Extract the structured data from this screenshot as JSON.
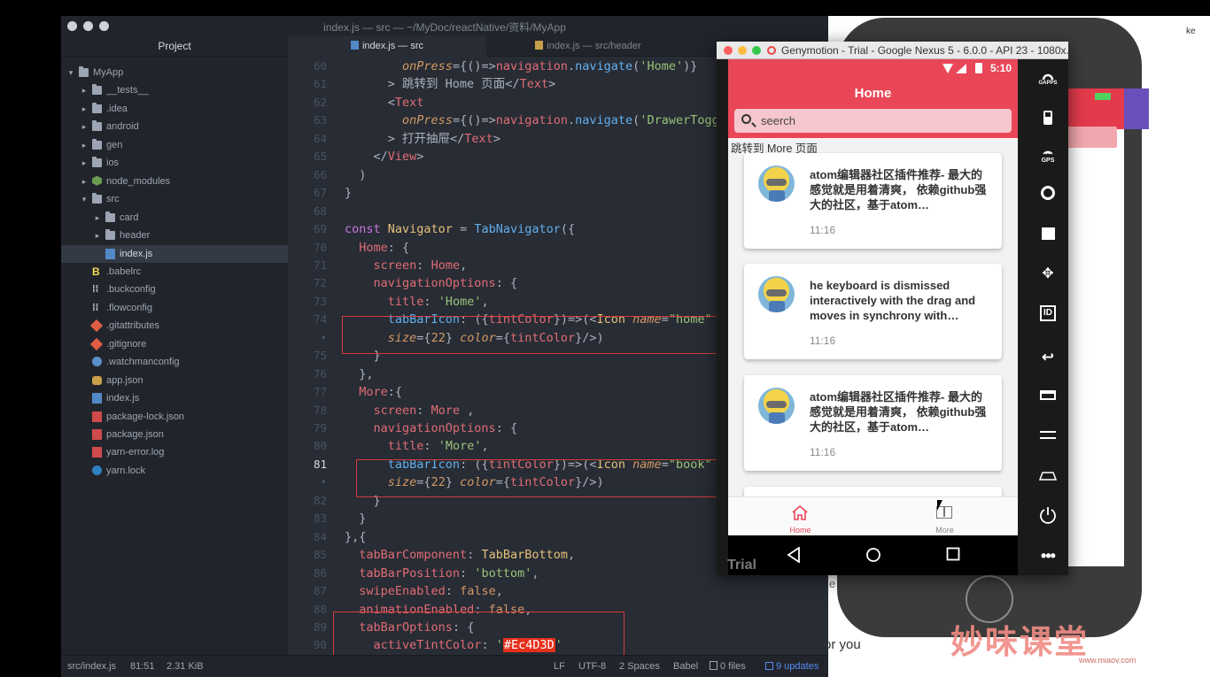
{
  "atom": {
    "window_title": "index.js — src — ~/MyDoc/reactNative/资料/MyApp",
    "tree_header": "Project",
    "tree": [
      {
        "label": "MyApp",
        "kind": "folder",
        "chev": "▾",
        "depth": 0
      },
      {
        "label": "__tests__",
        "kind": "folder",
        "chev": "▸",
        "depth": 1
      },
      {
        "label": ".idea",
        "kind": "folder",
        "chev": "▸",
        "depth": 1
      },
      {
        "label": "android",
        "kind": "folder",
        "chev": "▸",
        "depth": 1
      },
      {
        "label": "gen",
        "kind": "folder",
        "chev": "▸",
        "depth": 1
      },
      {
        "label": "ios",
        "kind": "folder",
        "chev": "▸",
        "depth": 1
      },
      {
        "label": "node_modules",
        "kind": "nm",
        "chev": "▸",
        "depth": 1
      },
      {
        "label": "src",
        "kind": "folder",
        "chev": "▾",
        "depth": 1
      },
      {
        "label": "card",
        "kind": "folder",
        "chev": "▸",
        "depth": 2
      },
      {
        "label": "header",
        "kind": "folder",
        "chev": "▸",
        "depth": 2
      },
      {
        "label": "index.js",
        "kind": "js",
        "chev": "",
        "depth": 2,
        "selected": true
      },
      {
        "label": ".babelrc",
        "kind": "babel",
        "chev": "",
        "depth": 1
      },
      {
        "label": ".buckconfig",
        "kind": "cfg",
        "chev": "",
        "depth": 1
      },
      {
        "label": ".flowconfig",
        "kind": "cfg",
        "chev": "",
        "depth": 1
      },
      {
        "label": ".gitattributes",
        "kind": "git",
        "chev": "",
        "depth": 1
      },
      {
        "label": ".gitignore",
        "kind": "git",
        "chev": "",
        "depth": 1
      },
      {
        "label": ".watchmanconfig",
        "kind": "eye",
        "chev": "",
        "depth": 1
      },
      {
        "label": "app.json",
        "kind": "db",
        "chev": "",
        "depth": 1
      },
      {
        "label": "index.js",
        "kind": "js",
        "chev": "",
        "depth": 1
      },
      {
        "label": "package-lock.json",
        "kind": "json",
        "chev": "",
        "depth": 1
      },
      {
        "label": "package.json",
        "kind": "json",
        "chev": "",
        "depth": 1
      },
      {
        "label": "yarn-error.log",
        "kind": "log",
        "chev": "",
        "depth": 1
      },
      {
        "label": "yarn.lock",
        "kind": "yarn",
        "chev": "",
        "depth": 1
      }
    ],
    "tabs": [
      {
        "label": "index.js — src",
        "active": true
      },
      {
        "label": "index.js — src/header",
        "active": false
      }
    ],
    "code_lines": [
      {
        "num": "60",
        "html": "        <span class=\"a\">onPress</span><span class=\"p\">={()=></span><span class=\"v\">navigation</span><span class=\"p\">.</span><span class=\"f\">navigate</span><span class=\"p\">(</span><span class=\"s\">'Home'</span><span class=\"p\">)}</span>"
      },
      {
        "num": "61",
        "html": "      <span class=\"p\">&gt; 跳转到 Home 页面&lt;/</span><span class=\"tg\">Text</span><span class=\"p\">&gt;</span>"
      },
      {
        "num": "62",
        "html": "      <span class=\"p\">&lt;</span><span class=\"tg\">Text</span>"
      },
      {
        "num": "63",
        "html": "        <span class=\"a\">onPress</span><span class=\"p\">={()=></span><span class=\"v\">navigation</span><span class=\"p\">.</span><span class=\"f\">navigate</span><span class=\"p\">(</span><span class=\"s\">'DrawerToggle'</span>"
      },
      {
        "num": "64",
        "html": "      <span class=\"p\">&gt; 打开抽屉&lt;/</span><span class=\"tg\">Text</span><span class=\"p\">&gt;</span>"
      },
      {
        "num": "65",
        "html": "    <span class=\"p\">&lt;/</span><span class=\"tg\">View</span><span class=\"p\">&gt;</span>"
      },
      {
        "num": "66",
        "html": "  <span class=\"p\">)</span>"
      },
      {
        "num": "67",
        "html": "<span class=\"p\">}</span>"
      },
      {
        "num": "68",
        "html": ""
      },
      {
        "num": "69",
        "html": "<span class=\"k\">const</span> <span class=\"t\">Navigator</span> <span class=\"p\">=</span> <span class=\"f\">TabNavigator</span><span class=\"p\">({</span>"
      },
      {
        "num": "70",
        "html": "  <span class=\"v\">Home</span><span class=\"p\">: {</span>"
      },
      {
        "num": "71",
        "html": "    <span class=\"v\">screen</span><span class=\"p\">: </span><span class=\"v\">Home</span><span class=\"p\">,</span>"
      },
      {
        "num": "72",
        "html": "    <span class=\"v\">navigationOptions</span><span class=\"p\">: {</span>"
      },
      {
        "num": "73",
        "html": "      <span class=\"v\">title</span><span class=\"p\">: </span><span class=\"s\">'Home'</span><span class=\"p\">,</span>"
      },
      {
        "num": "74",
        "html": "      <span class=\"f\">tabBarIcon</span><span class=\"p\">: ({</span><span class=\"v\">tintColor</span><span class=\"p\">})=>(&lt;</span><span class=\"t\">Icon</span> <span class=\"a\">name</span><span class=\"p\">=</span><span class=\"s\">\"home\"</span>"
      },
      {
        "num": "•",
        "html": "      <span class=\"a\">size</span><span class=\"p\">={</span><span class=\"n\">22</span><span class=\"p\">} </span><span class=\"a\">color</span><span class=\"p\">={</span><span class=\"v\">tintColor</span><span class=\"p\">}/&gt;)</span>"
      },
      {
        "num": "75",
        "html": "    <span class=\"p\">}</span>"
      },
      {
        "num": "76",
        "html": "  <span class=\"p\">},</span>"
      },
      {
        "num": "77",
        "html": "  <span class=\"v\">More</span><span class=\"p\">:{</span>"
      },
      {
        "num": "78",
        "html": "    <span class=\"v\">screen</span><span class=\"p\">: </span><span class=\"v\">More</span> <span class=\"p\">,</span>"
      },
      {
        "num": "79",
        "html": "    <span class=\"v\">navigationOptions</span><span class=\"p\">: {</span>"
      },
      {
        "num": "80",
        "html": "      <span class=\"v\">title</span><span class=\"p\">: </span><span class=\"s\">'More'</span><span class=\"p\">,</span>"
      },
      {
        "num": "81",
        "html": "      <span class=\"f\">tabBarIcon</span><span class=\"p\">: ({</span><span class=\"v\">tintColor</span><span class=\"p\">})=>(&lt;</span><span class=\"t\">Icon</span> <span class=\"a\">name</span><span class=\"p\">=</span><span class=\"s\">\"book\"</span>",
        "current": true
      },
      {
        "num": "•",
        "html": "      <span class=\"a\">size</span><span class=\"p\">={</span><span class=\"n\">22</span><span class=\"p\">} </span><span class=\"a\">color</span><span class=\"p\">={</span><span class=\"v\">tintColor</span><span class=\"p\">}/&gt;)</span>"
      },
      {
        "num": "82",
        "html": "    <span class=\"p\">}</span>"
      },
      {
        "num": "83",
        "html": "  <span class=\"p\">}</span>"
      },
      {
        "num": "84",
        "html": "<span class=\"p\">},{</span>"
      },
      {
        "num": "85",
        "html": "  <span class=\"v\">tabBarComponent</span><span class=\"p\">: </span><span class=\"t\">TabBarBottom</span><span class=\"p\">,</span>"
      },
      {
        "num": "86",
        "html": "  <span class=\"v\">tabBarPosition</span><span class=\"p\">: </span><span class=\"s\">'bottom'</span><span class=\"p\">,</span>"
      },
      {
        "num": "87",
        "html": "  <span class=\"v\">swipeEnabled</span><span class=\"p\">: </span><span class=\"n\">false</span><span class=\"p\">,</span>"
      },
      {
        "num": "88",
        "html": "  <span class=\"v\">animationEnabled</span><span class=\"p\">: </span><span class=\"n\">false</span><span class=\"p\">,</span>"
      },
      {
        "num": "89",
        "html": "  <span class=\"v\">tabBarOptions</span><span class=\"p\">: {</span>"
      },
      {
        "num": "90",
        "html": "    <span class=\"v\">activeTintColor</span><span class=\"p\">: </span><span class=\"s\">'<span class=\"hex-hl\">#Ec4D3D</span>'</span>"
      }
    ],
    "status": {
      "path": "src/index.js",
      "cursor": "81:51",
      "size": "2.31 KiB",
      "line_ending": "LF",
      "encoding": "UTF-8",
      "indent": "2 Spaces",
      "grammar": "Babel",
      "files": "0 files",
      "updates": "9 updates"
    }
  },
  "genymotion": {
    "title": "Genymotion - Trial - Google Nexus 5 - 6.0.0 - API 23 - 1080x...",
    "trial_label": "Trial",
    "side_icons": [
      "gapps-icon",
      "battery-icon",
      "gps-icon",
      "camera-icon",
      "media-icon",
      "dpad-icon",
      "id-icon",
      "back-icon",
      "recent-apps-icon",
      "menu-icon",
      "home-icon",
      "power-icon",
      "more-icon"
    ],
    "side_labels": {
      "gapps": "GAPPS",
      "gps": "GPS",
      "id": "ID"
    }
  },
  "app": {
    "time": "5:10",
    "title": "Home",
    "search_placeholder": "seerch",
    "link_text": "跳转到 More 页面",
    "cards": [
      {
        "text": "atom编辑器社区插件推荐- 最大的 感觉就是用着清爽， 依赖github强大的社区，基于atom…",
        "time": "11:16"
      },
      {
        "text": "he keyboard is dismissed interactively with the drag and moves in synchrony with…",
        "time": "11:16"
      },
      {
        "text": "atom编辑器社区插件推荐- 最大的 感觉就是用着清爽， 依赖github强大的社区，基于atom…",
        "time": "11:16"
      }
    ],
    "tabs": [
      {
        "label": "Home",
        "active": true
      },
      {
        "label": "More",
        "active": false
      }
    ],
    "accent": "#e94657"
  },
  "background": {
    "watermark": "妙味课堂",
    "watermark_url": "www.miaov.com",
    "text_ke": "ke",
    "text_or_you": "or you",
    "text_es": "e"
  }
}
